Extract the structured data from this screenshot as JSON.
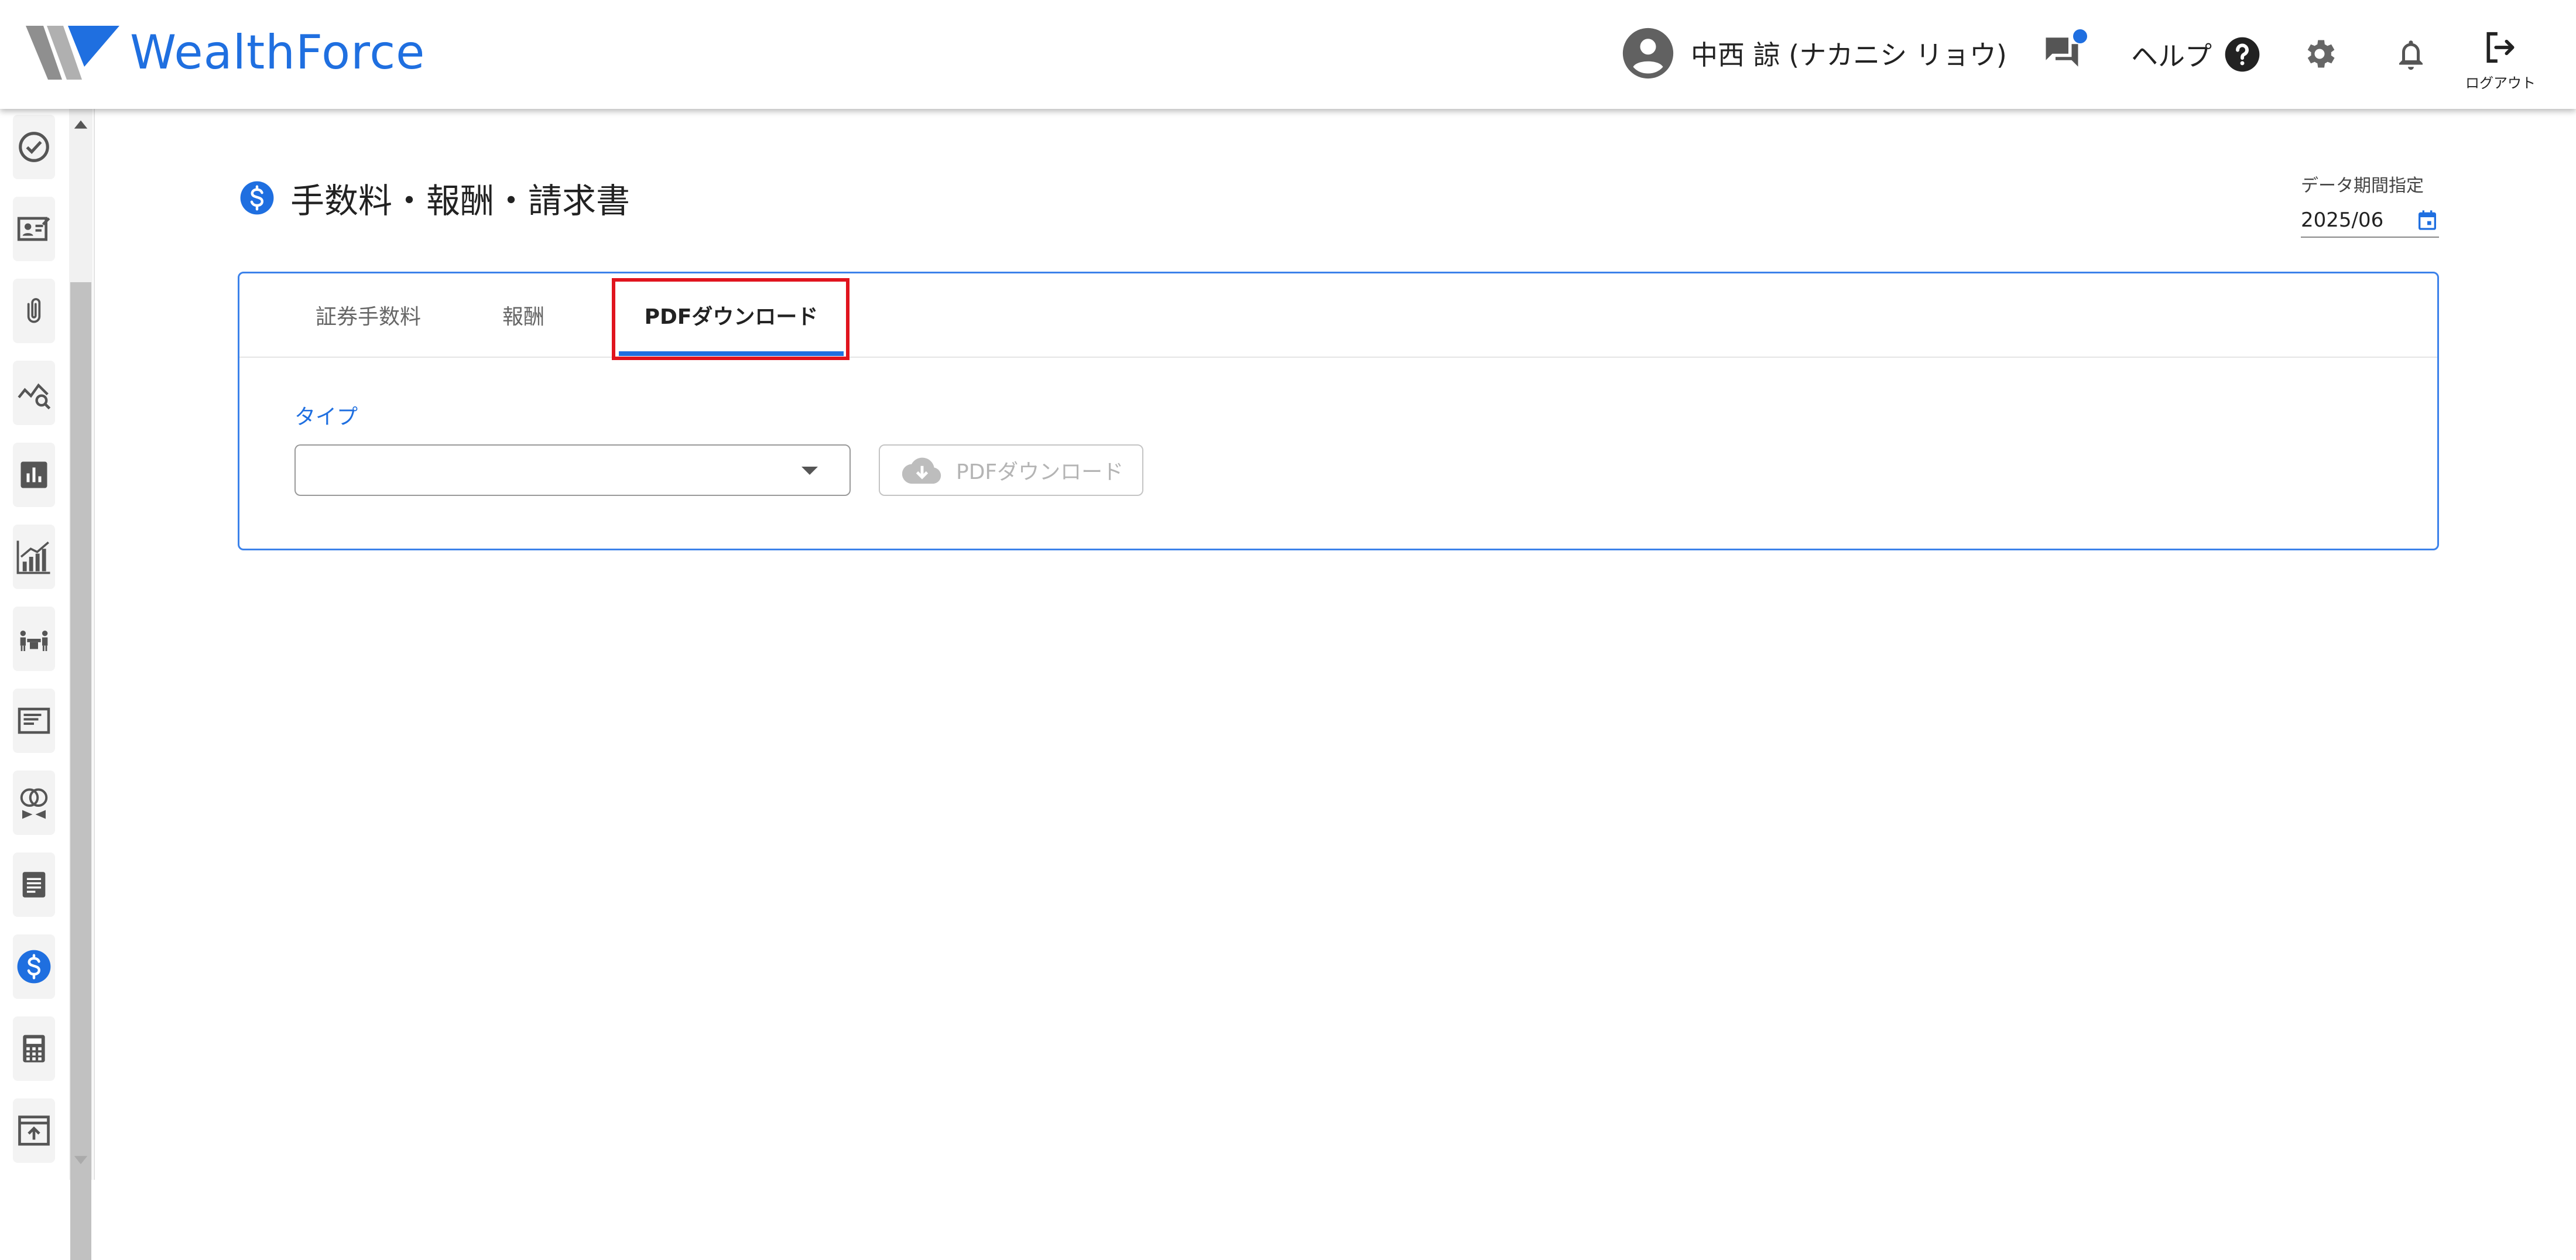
{
  "header": {
    "brand": "WealthForce",
    "user_name": "中西 諒 (ナカニシ リョウ)",
    "help_label": "ヘルプ",
    "logout_label": "ログアウト",
    "icons": [
      "account-circle-icon",
      "chat-icon",
      "help-circle-icon",
      "gear-icon",
      "bell-icon",
      "logout-icon"
    ]
  },
  "sidebar": {
    "items": [
      {
        "icon": "check-circle-icon"
      },
      {
        "icon": "contact-card-icon"
      },
      {
        "icon": "paperclip-icon"
      },
      {
        "icon": "chart-search-icon"
      },
      {
        "icon": "bar-chart-icon"
      },
      {
        "icon": "growth-chart-icon"
      },
      {
        "icon": "meeting-icon"
      },
      {
        "icon": "article-icon"
      },
      {
        "icon": "rings-icon"
      },
      {
        "icon": "document-icon"
      },
      {
        "icon": "dollar-icon",
        "active": true
      },
      {
        "icon": "calculator-icon"
      },
      {
        "icon": "upload-icon"
      }
    ]
  },
  "page": {
    "title": "手数料・報酬・請求書",
    "period_label": "データ期間指定",
    "period_value": "2025/06"
  },
  "tabs": [
    {
      "label": "証券手数料",
      "active": false
    },
    {
      "label": "報酬",
      "active": false
    },
    {
      "label": "PDFダウンロード",
      "active": true
    }
  ],
  "form": {
    "type_label": "タイプ",
    "type_value": "",
    "download_button": "PDFダウンロード",
    "download_enabled": false
  },
  "colors": {
    "brand": "#1f6fe0",
    "highlight": "#e0141e",
    "card_border": "#3c82ea"
  }
}
